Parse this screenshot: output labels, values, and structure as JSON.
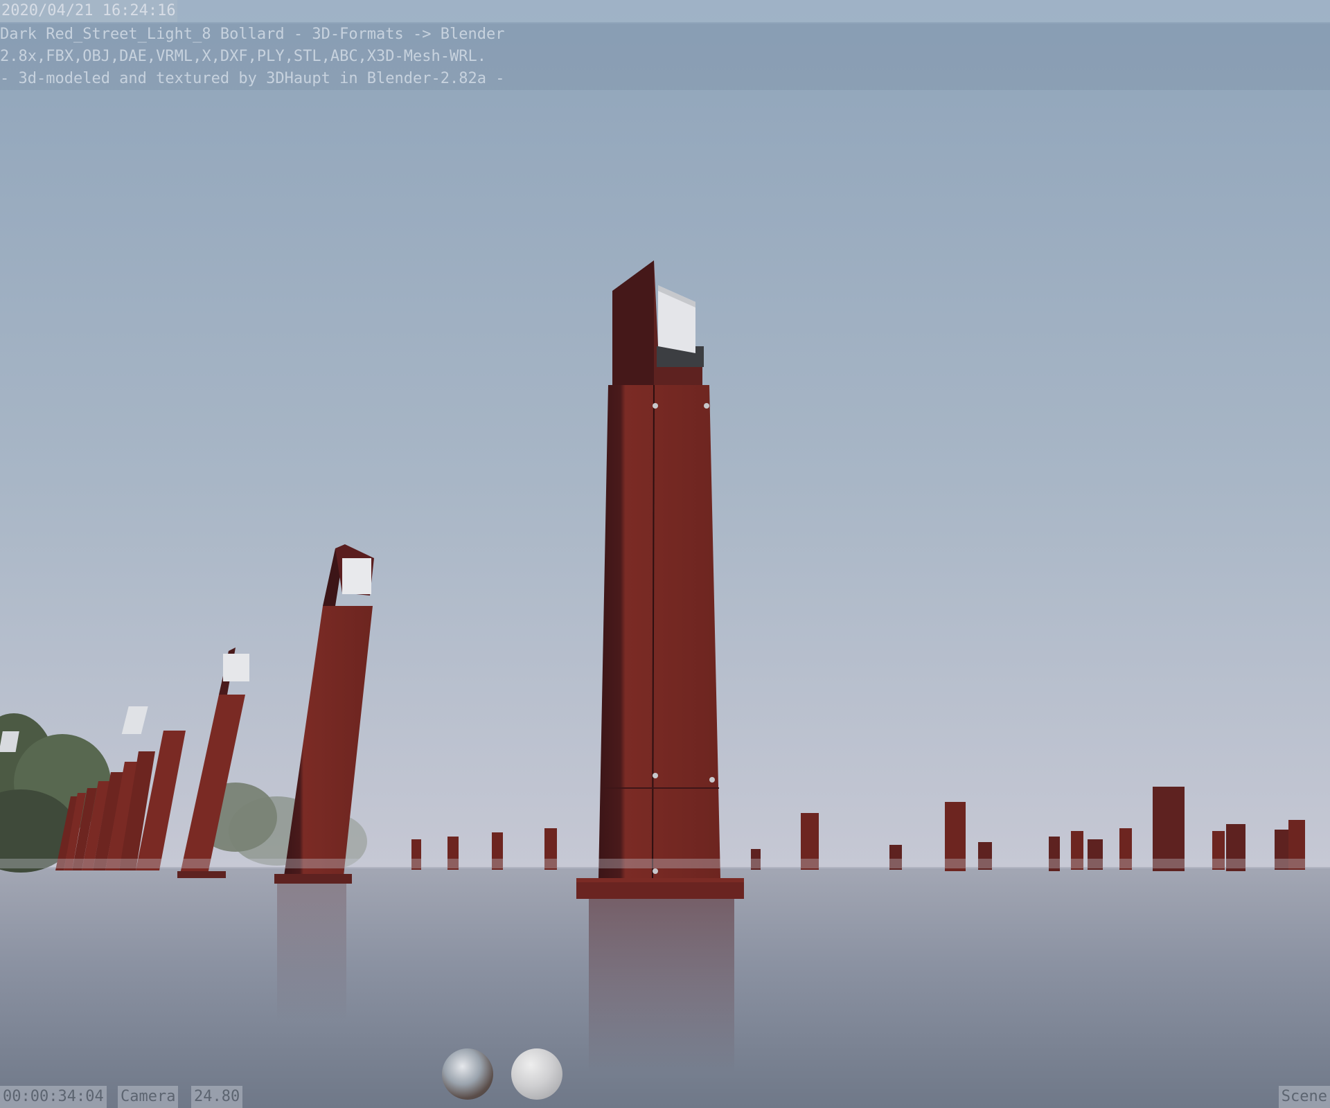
{
  "overlay": {
    "timestamp": "2020/04/21 16:24:16",
    "lines": [
      "Dark Red_Street_Light_8 Bollard  - 3D-Formats -> Blender",
      "2.8x,FBX,OBJ,DAE,VRML,X,DXF,PLY,STL,ABC,X3D-Mesh-WRL.",
      "-  3d-modeled and textured by 3DHaupt in Blender-2.82a -"
    ]
  },
  "status_bar": {
    "time": "00:00:34:04",
    "camera": "Camera",
    "focal": "24.80",
    "scene": "Scene"
  },
  "colors": {
    "sky_top": "#8fa4ba",
    "sky_bottom": "#c3c7d4",
    "ground": "#8a93a2",
    "bollard_red": "#7a2a24",
    "bollard_dark": "#3e1618"
  },
  "icons": {
    "hdri_preview": "environment-sphere-icon",
    "material_preview": "material-sphere-icon"
  }
}
